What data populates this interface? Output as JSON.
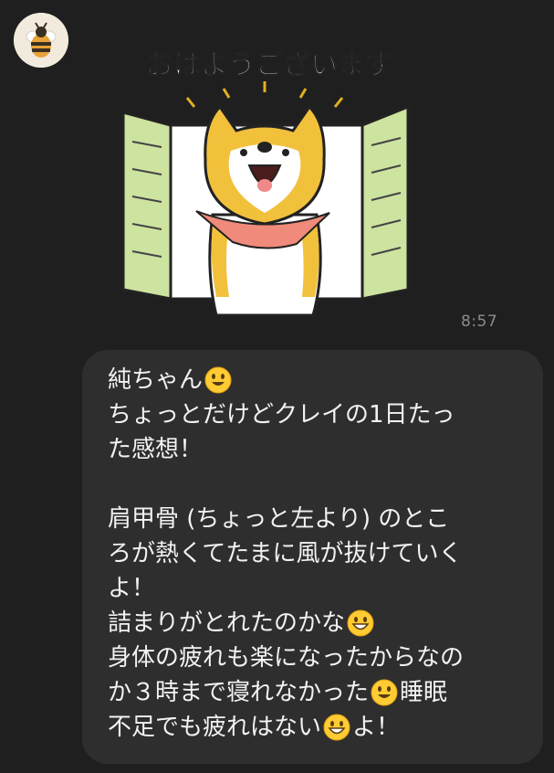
{
  "conversation": {
    "sender_avatar_icon": "bee-icon",
    "sticker": {
      "text": "おはようございます",
      "icon": "shiba-dog-sticker-icon"
    },
    "sticker_time": "8:57",
    "message": {
      "lines": [
        {
          "parts": [
            {
              "t": "text",
              "v": "純ちゃん"
            },
            {
              "t": "emoji",
              "v": "smile-emoji-icon"
            }
          ]
        },
        {
          "parts": [
            {
              "t": "text",
              "v": "ちょっとだけどクレイの1日たっ"
            }
          ]
        },
        {
          "parts": [
            {
              "t": "text",
              "v": "た感想！"
            }
          ]
        },
        {
          "parts": []
        },
        {
          "parts": [
            {
              "t": "text",
              "v": "肩甲骨 (ちょっと左より) のとこ"
            }
          ]
        },
        {
          "parts": [
            {
              "t": "text",
              "v": "ろが熱くてたまに風が抜けていく"
            }
          ]
        },
        {
          "parts": [
            {
              "t": "text",
              "v": "よ！"
            }
          ]
        },
        {
          "parts": [
            {
              "t": "text",
              "v": "詰まりがとれたのかな"
            },
            {
              "t": "emoji",
              "v": "grin-emoji-icon"
            }
          ]
        },
        {
          "parts": [
            {
              "t": "text",
              "v": "身体の疲れも楽になったからなの"
            }
          ]
        },
        {
          "parts": [
            {
              "t": "text",
              "v": "か３時まで寝れなかった"
            },
            {
              "t": "emoji",
              "v": "smile-emoji-icon"
            },
            {
              "t": "text",
              "v": "睡眠"
            }
          ]
        },
        {
          "parts": [
            {
              "t": "text",
              "v": "不足でも疲れはない"
            },
            {
              "t": "emoji",
              "v": "grin-emoji-icon"
            },
            {
              "t": "text",
              "v": "よ！"
            }
          ]
        }
      ]
    }
  }
}
